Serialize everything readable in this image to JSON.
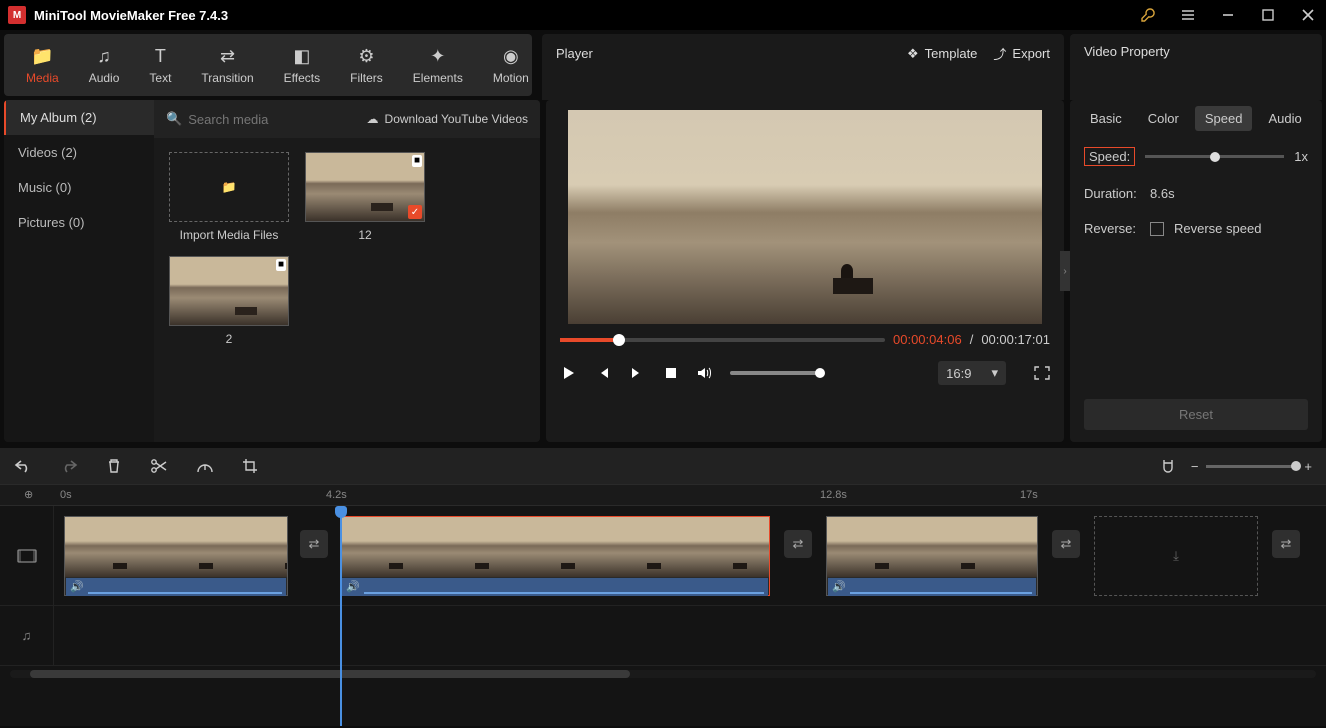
{
  "app": {
    "title": "MiniTool MovieMaker Free 7.4.3"
  },
  "tooltabs": {
    "media": "Media",
    "audio": "Audio",
    "text": "Text",
    "transition": "Transition",
    "effects": "Effects",
    "filters": "Filters",
    "elements": "Elements",
    "motion": "Motion"
  },
  "sidebar": {
    "album_hdr": "My Album (2)",
    "items": {
      "videos": "Videos (2)",
      "music": "Music (0)",
      "pictures": "Pictures (0)"
    }
  },
  "library": {
    "search_placeholder": "Search media",
    "download_label": "Download YouTube Videos",
    "import_label": "Import Media Files",
    "clip1_name": "12",
    "clip2_name": "2"
  },
  "player": {
    "title": "Player",
    "template_label": "Template",
    "export_label": "Export",
    "time_cur": "00:00:04:06",
    "time_sep": " / ",
    "time_total": "00:00:17:01",
    "aspect": "16:9"
  },
  "property": {
    "title": "Video Property",
    "tabs": {
      "basic": "Basic",
      "color": "Color",
      "speed": "Speed",
      "audio": "Audio"
    },
    "speed_label": "Speed:",
    "speed_value": "1x",
    "duration_label": "Duration:",
    "duration_value": "8.6s",
    "reverse_label": "Reverse:",
    "reverse_text": "Reverse speed",
    "reset_label": "Reset"
  },
  "ruler": {
    "t0": "0s",
    "t1": "4.2s",
    "t2": "12.8s",
    "t3": "17s"
  }
}
